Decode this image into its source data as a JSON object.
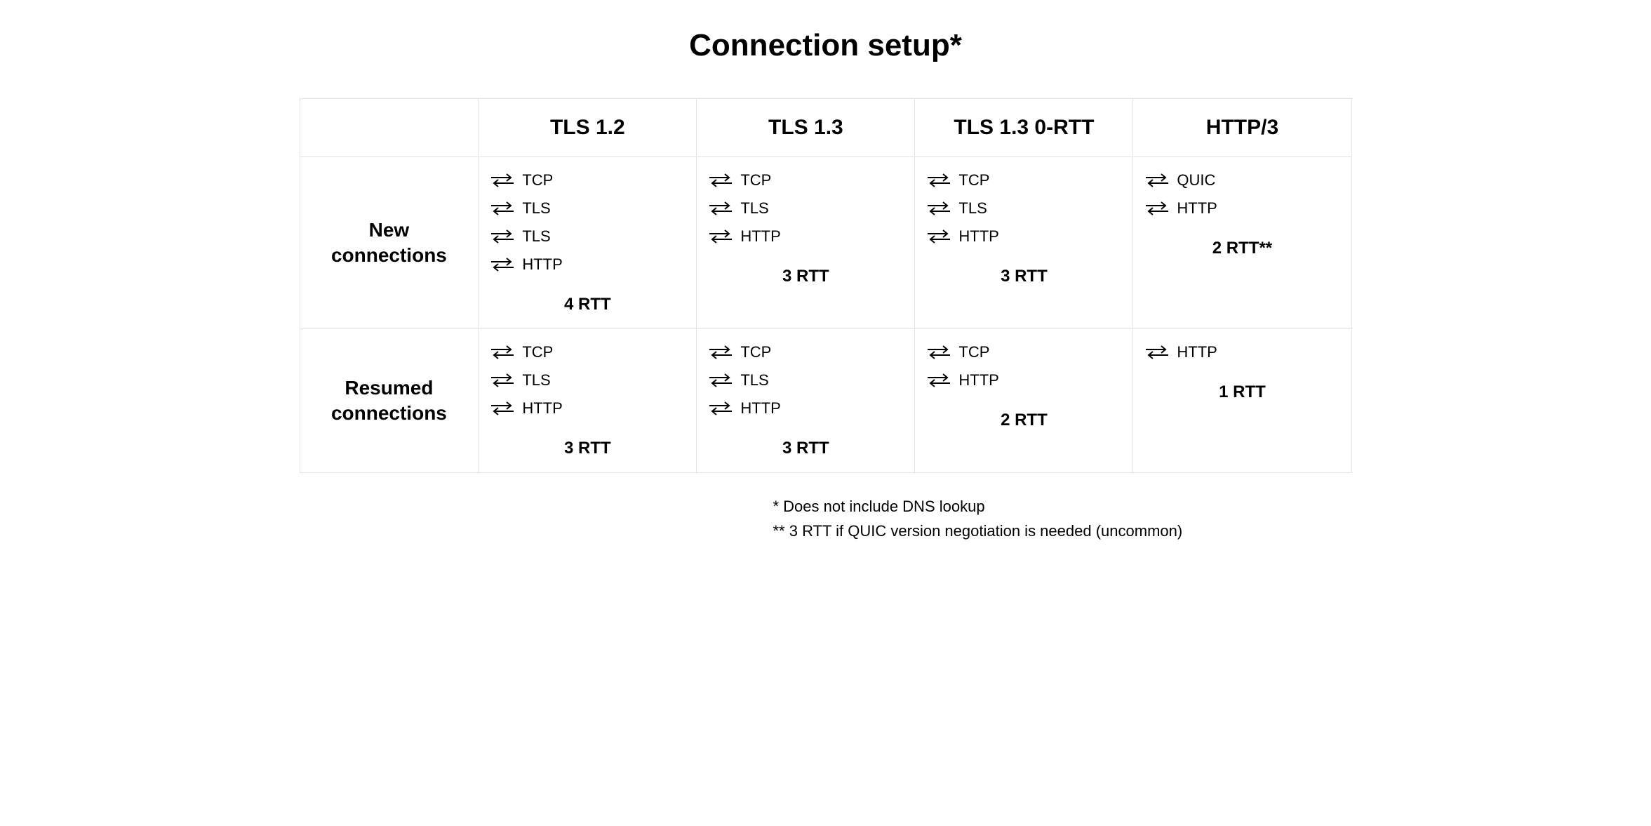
{
  "title": "Connection setup*",
  "columns": [
    "TLS 1.2",
    "TLS 1.3",
    "TLS 1.3 0-RTT",
    "HTTP/3"
  ],
  "rows": {
    "new": {
      "label": "New\nconnections",
      "cells": [
        {
          "steps": [
            "TCP",
            "TLS",
            "TLS",
            "HTTP"
          ],
          "rtt": "4 RTT"
        },
        {
          "steps": [
            "TCP",
            "TLS",
            "HTTP"
          ],
          "rtt": "3 RTT"
        },
        {
          "steps": [
            "TCP",
            "TLS",
            "HTTP"
          ],
          "rtt": "3 RTT"
        },
        {
          "steps": [
            "QUIC",
            "HTTP"
          ],
          "rtt": "2 RTT**"
        }
      ]
    },
    "resumed": {
      "label": "Resumed\nconnections",
      "cells": [
        {
          "steps": [
            "TCP",
            "TLS",
            "HTTP"
          ],
          "rtt": "3 RTT"
        },
        {
          "steps": [
            "TCP",
            "TLS",
            "HTTP"
          ],
          "rtt": "3 RTT"
        },
        {
          "steps": [
            "TCP",
            "HTTP"
          ],
          "rtt": "2 RTT"
        },
        {
          "steps": [
            "HTTP"
          ],
          "rtt": "1 RTT"
        }
      ]
    }
  },
  "footnotes": {
    "f1": "* Does not include DNS lookup",
    "f2": "** 3 RTT if QUIC version negotiation is needed (uncommon)"
  }
}
